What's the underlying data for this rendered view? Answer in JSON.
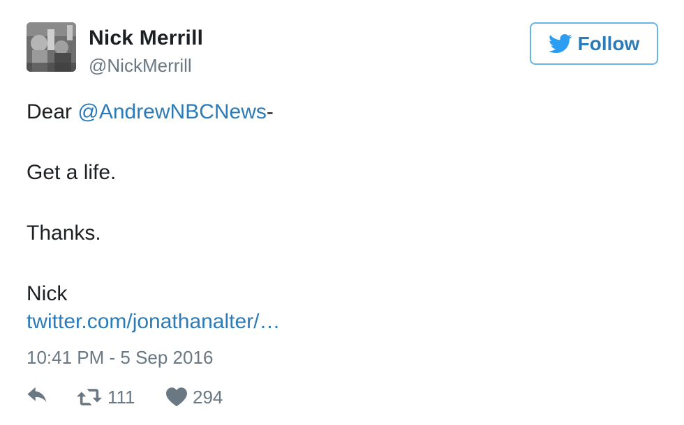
{
  "user": {
    "display_name": "Nick Merrill",
    "handle": "@NickMerrill"
  },
  "follow_button": {
    "label": "Follow",
    "icon": "twitter-bird-icon",
    "border_color": "#66b5e7",
    "text_color": "#2b7bb9"
  },
  "tweet": {
    "greeting": "Dear ",
    "mention": "@AndrewNBCNews",
    "greeting_suffix": "-",
    "line2": "Get a life.",
    "line3": "Thanks.",
    "line4": "Nick",
    "link": "twitter.com/jonathanalter/…"
  },
  "timestamp": "10:41 PM - 5 Sep 2016",
  "actions": {
    "reply_icon": "reply-icon",
    "retweet_icon": "retweet-icon",
    "retweet_count": "111",
    "like_icon": "heart-icon",
    "like_count": "294"
  },
  "colors": {
    "link": "#2b7bb9",
    "muted": "#697882",
    "text": "#1c2022"
  }
}
